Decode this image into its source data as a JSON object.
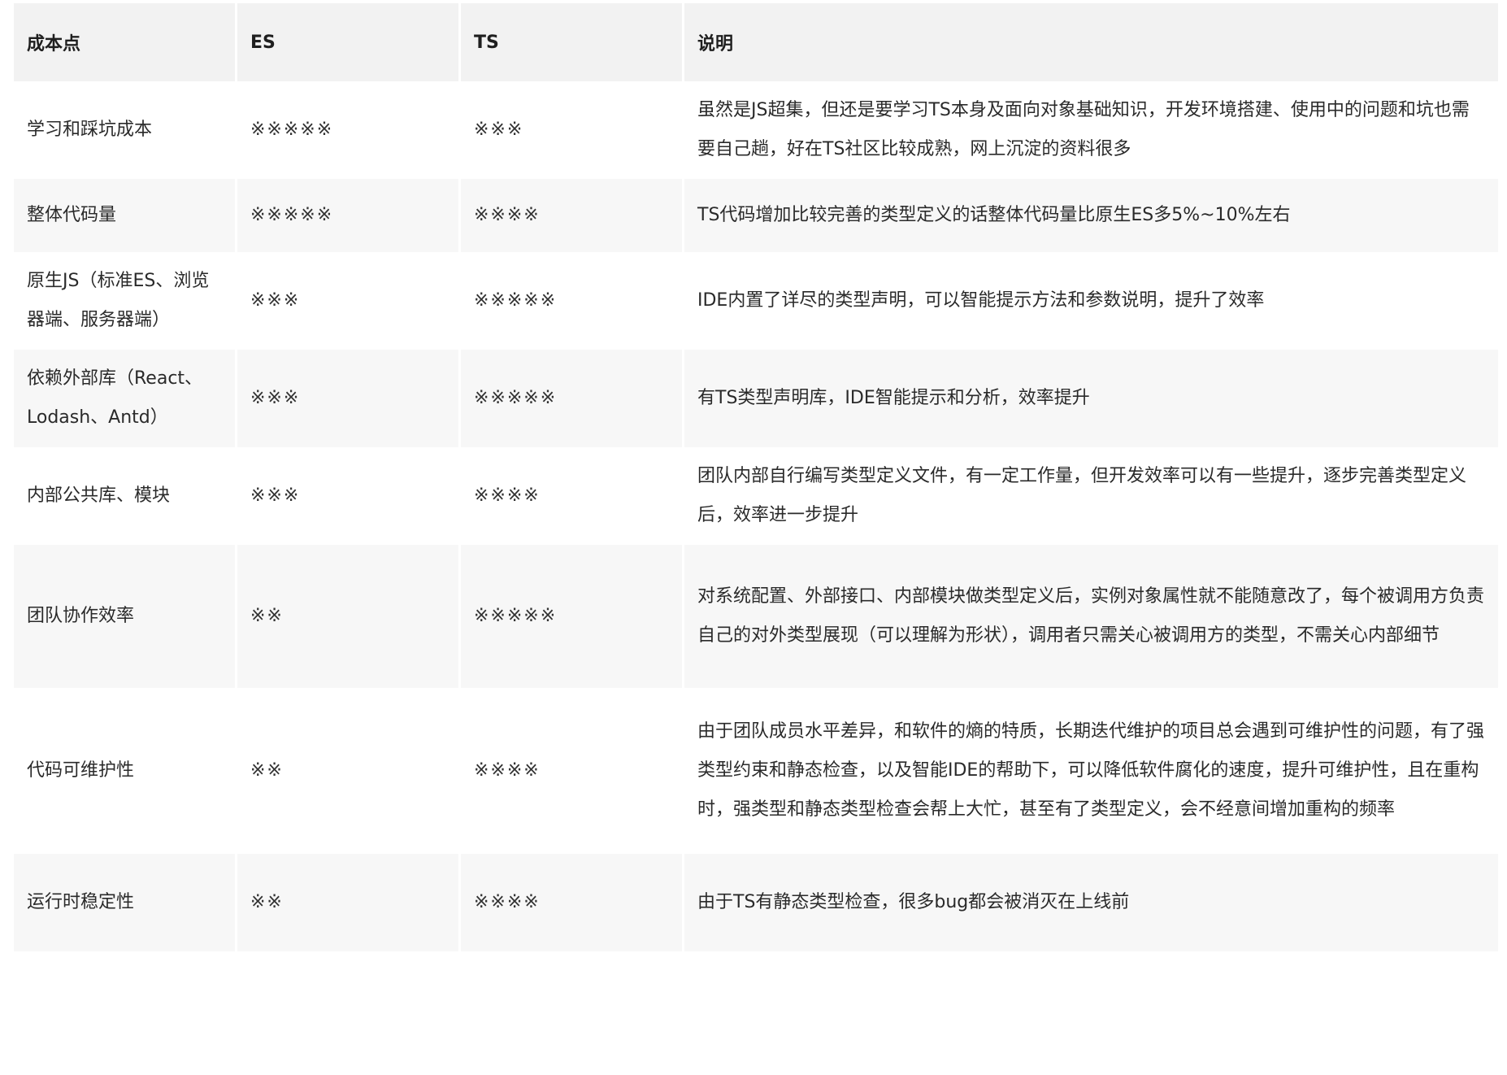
{
  "table": {
    "headers": [
      "成本点",
      "ES",
      "TS",
      "说明"
    ],
    "rows": [
      {
        "cost_point": "学习和踩坑成本",
        "es": "※※※※※",
        "ts": "※※※",
        "description": "虽然是JS超集，但还是要学习TS本身及面向对象基础知识，开发环境搭建、使用中的问题和坑也需要自己趟，好在TS社区比较成熟，网上沉淀的资料很多"
      },
      {
        "cost_point": "整体代码量",
        "es": "※※※※※",
        "ts": "※※※※",
        "description": "TS代码增加比较完善的类型定义的话整体代码量比原生ES多5%~10%左右"
      },
      {
        "cost_point": "原生JS（标准ES、浏览器端、服务器端）",
        "es": "※※※",
        "ts": "※※※※※",
        "description": "IDE内置了详尽的类型声明，可以智能提示方法和参数说明，提升了效率"
      },
      {
        "cost_point": "依赖外部库（React、Lodash、Antd）",
        "es": "※※※",
        "ts": "※※※※※",
        "description": "有TS类型声明库，IDE智能提示和分析，效率提升"
      },
      {
        "cost_point": "内部公共库、模块",
        "es": "※※※",
        "ts": "※※※※",
        "description": "团队内部自行编写类型定义文件，有一定工作量，但开发效率可以有一些提升，逐步完善类型定义后，效率进一步提升"
      },
      {
        "cost_point": "团队协作效率",
        "es": "※※",
        "ts": "※※※※※",
        "description": "对系统配置、外部接口、内部模块做类型定义后，实例对象属性就不能随意改了，每个被调用方负责自己的对外类型展现（可以理解为形状），调用者只需关心被调用方的类型，不需关心内部细节"
      },
      {
        "cost_point": "代码可维护性",
        "es": "※※",
        "ts": "※※※※",
        "description": "由于团队成员水平差异，和软件的熵的特质，长期迭代维护的项目总会遇到可维护性的问题，有了强类型约束和静态检查，以及智能IDE的帮助下，可以降低软件腐化的速度，提升可维护性，且在重构时，强类型和静态类型检查会帮上大忙，甚至有了类型定义，会不经意间增加重构的频率"
      },
      {
        "cost_point": "运行时稳定性",
        "es": "※※",
        "ts": "※※※※",
        "description": "由于TS有静态类型检查，很多bug都会被消灭在上线前"
      }
    ]
  }
}
